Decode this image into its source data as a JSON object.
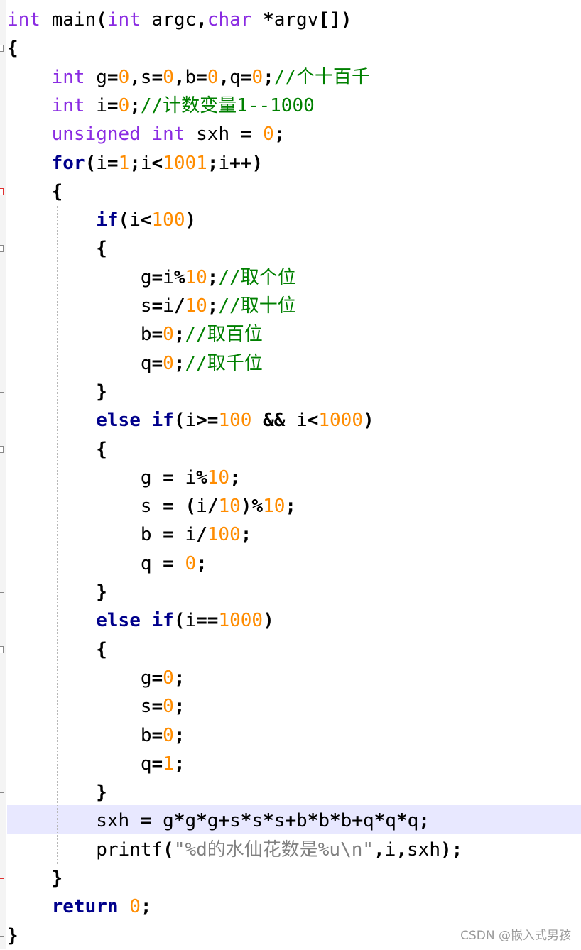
{
  "code_lines": [
    "int main(int argc,char *argv[])",
    "{",
    "    int g=0,s=0,b=0,q=0;//个十百千",
    "    int i=0;//计数变量1--1000",
    "    unsigned int sxh = 0;",
    "    for(i=1;i<1001;i++)",
    "    {",
    "        if(i<100)",
    "        {",
    "            g=i%10;//取个位",
    "            s=i/10;//取十位",
    "            b=0;//取百位",
    "            q=0;//取千位",
    "        }",
    "        else if(i>=100 && i<1000)",
    "        {",
    "            g = i%10;",
    "            s = (i/10)%10;",
    "            b = i/100;",
    "            q = 0;",
    "        }",
    "        else if(i==1000)",
    "        {",
    "            g=0;",
    "            s=0;",
    "            b=0;",
    "            q=1;",
    "        }",
    "        sxh = g*g*g+s*s*s+b*b*b+q*q*q;",
    "        printf(\"%d的水仙花数是%u\\n\",i,sxh);",
    "    }",
    "    return 0;",
    "}"
  ],
  "highlighted_line": 29,
  "colors": {
    "type_keyword": "#8a2be2",
    "control_keyword": "#00008b",
    "number": "#ff8c00",
    "comment": "#008000",
    "string": "#808080",
    "highlight": "#e8e8ff"
  },
  "watermark": "CSDN @嵌入式男孩"
}
